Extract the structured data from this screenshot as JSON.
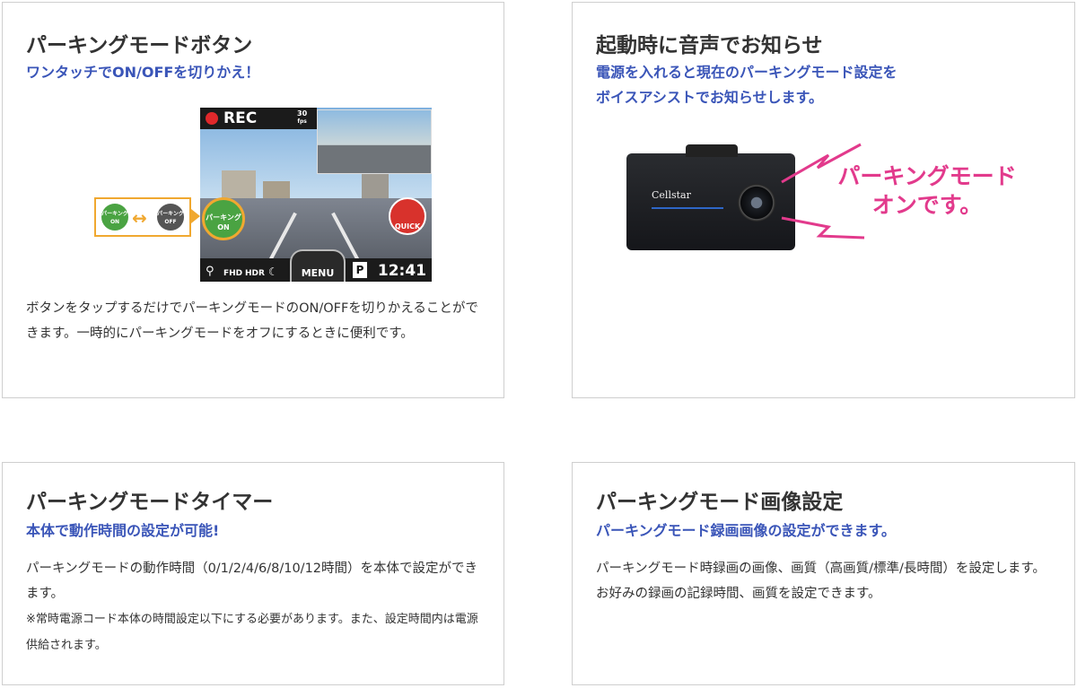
{
  "cards": [
    {
      "title": "パーキングモードボタン",
      "subtitle": "ワンタッチでON/OFFを切りかえ！",
      "body": "ボタンをタップするだけでパーキングモードのON/OFFを切りかえることができます。一時的にパーキングモードをオフにするときに便利です。",
      "screen": {
        "rec_label": "REC",
        "fps_value": "30",
        "fps_unit": "fps",
        "park_label": "パーキング",
        "park_state": "ON",
        "toggle_on_label": "パーキング",
        "toggle_on_state": "ON",
        "toggle_off_label": "パーキング",
        "toggle_off_state": "OFF",
        "toggle_arrow": "↔",
        "quick_label": "QUICK",
        "fhd": "FHD",
        "hdr": "HDR",
        "menu": "MENU",
        "p_badge": "P",
        "clock": "12:41"
      }
    },
    {
      "title": "起動時に音声でお知らせ",
      "subtitle_line1": "電源を入れると現在のパーキングモード設定を",
      "subtitle_line2": "ボイスアシストでお知らせします。",
      "camera_brand": "Cellstar",
      "speech_line1": "パーキングモード",
      "speech_line2": "オンです。"
    },
    {
      "title": "パーキングモードタイマー",
      "subtitle": "本体で動作時間の設定が可能!",
      "body": "パーキングモードの動作時間（0/1/2/4/6/8/10/12時間）を本体で設定ができます。",
      "note": "※常時電源コード本体の時間設定以下にする必要があります。また、設定時間内は電源供給されます。"
    },
    {
      "title": "パーキングモード画像設定",
      "subtitle": "パーキングモード録画画像の設定ができます。",
      "body": "パーキングモード時録画の画像、画質（高画質/標準/長時間）を設定します。お好みの録画の記録時間、画質を設定できます。"
    }
  ],
  "colors": {
    "accent_blue": "#3a55b8",
    "speech_pink": "#e23a8c",
    "rec_red": "#e0282b",
    "park_green": "#4aa342",
    "highlight_orange": "#f0a830"
  }
}
